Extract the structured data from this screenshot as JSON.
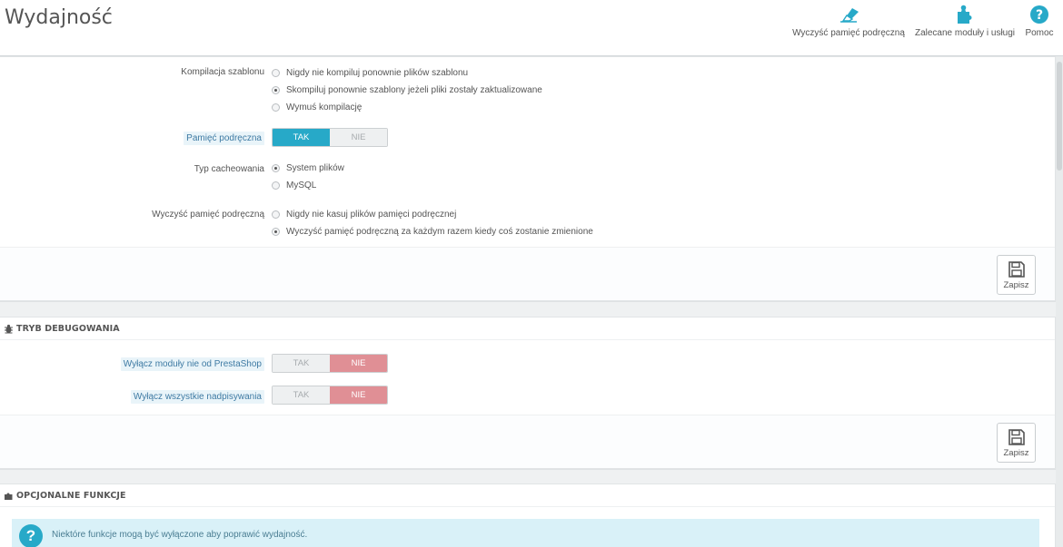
{
  "header": {
    "title": "Wydajność",
    "toolbar": [
      {
        "label": "Wyczyść pamięć podręczną",
        "icon": "eraser-icon"
      },
      {
        "label": "Zalecane moduły i usługi",
        "icon": "puzzle-icon"
      },
      {
        "label": "Pomoc",
        "icon": "help-icon"
      }
    ]
  },
  "smarty": {
    "compile_label": "Kompilacja szablonu",
    "compile_options": [
      "Nigdy nie kompiluj ponownie plików szablonu",
      "Skompiluj ponownie szablony jeżeli pliki zostały zaktualizowane",
      "Wymuś kompilację"
    ],
    "compile_selected": 1,
    "cache_label": "Pamięć podręczna",
    "cache_value": "TAK",
    "cache_yes": "TAK",
    "cache_no": "NIE",
    "cache_type_label": "Typ cacheowania",
    "cache_type_options": [
      "System plików",
      "MySQL"
    ],
    "cache_type_selected": 0,
    "clear_cache_label": "Wyczyść pamięć podręczną",
    "clear_cache_options": [
      "Nigdy nie kasuj plików pamięci podręcznej",
      "Wyczyść pamięć podręczną za każdym razem kiedy coś zostanie zmienione"
    ],
    "clear_cache_selected": 1,
    "save_label": "Zapisz"
  },
  "debug": {
    "heading": "TRYB DEBUGOWANIA",
    "disable_modules_label": "Wyłącz moduły nie od PrestaShop",
    "disable_overrides_label": "Wyłącz wszystkie nadpisywania",
    "yes": "TAK",
    "no": "NIE",
    "disable_modules_value": "NIE",
    "disable_overrides_value": "NIE",
    "save_label": "Zapisz"
  },
  "optional": {
    "heading": "OPCJONALNE FUNKCJE",
    "info_text": "Niektóre funkcje mogą być wyłączone aby poprawić wydajność.",
    "info_icon": "?"
  },
  "colors": {
    "accent": "#27a9c8",
    "danger_switch": "#e08f95",
    "label_highlight": "#e9f4f9"
  }
}
